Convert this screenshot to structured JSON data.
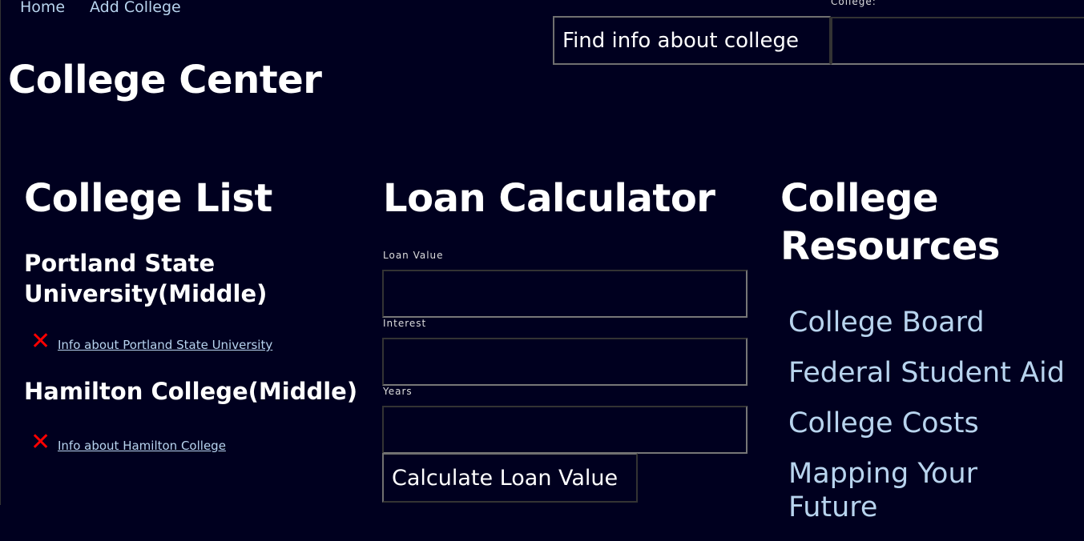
{
  "nav": {
    "home": "Home",
    "add_college": "Add College"
  },
  "header": {
    "title": "College Center",
    "find_button": "Find info about college",
    "college_label": "College:",
    "college_value": ""
  },
  "college_list": {
    "heading": "College List",
    "items": [
      {
        "name": "Portland State University(Middle)",
        "link": "Info about Portland State University"
      },
      {
        "name": "Hamilton College(Middle)",
        "link": "Info about Hamilton College"
      }
    ]
  },
  "loan": {
    "heading": "Loan Calculator",
    "loan_value_label": "Loan Value",
    "interest_label": "Interest",
    "years_label": "Years",
    "calc_button": "Calculate Loan Value"
  },
  "resources": {
    "heading": "College Resources",
    "links": [
      "College Board",
      "Federal Student Aid",
      "College Costs",
      "Mapping Your Future"
    ]
  },
  "colors": {
    "background": "#00001f",
    "link": "#b8d4ee",
    "delete": "#ff0000"
  }
}
